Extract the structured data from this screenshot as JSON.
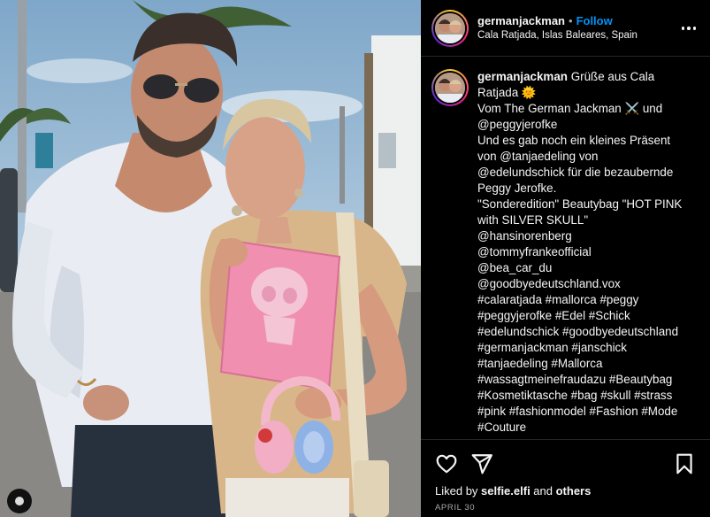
{
  "post": {
    "username": "germanjackman",
    "separator": "•",
    "follow_label": "Follow",
    "location": "Cala Ratjada, Islas Baleares, Spain",
    "caption_lines": [
      "Grüße aus Cala",
      "Ratjada 🌞",
      "Vom The German Jackman ⚔️ und",
      "@peggyjerofke",
      "Und es gab noch ein kleines Präsent",
      "von @tanjaedeling von",
      "@edelundschick für die bezaubernde",
      "Peggy Jerofke.",
      "\"Sonderedition\" Beautybag \"HOT PINK",
      "with SILVER SKULL\"",
      "@hansinorenberg",
      "@tommyfrankeofficial",
      "@bea_car_du",
      "@goodbyedeutschland.vox",
      "#calaratjada #mallorca #peggy",
      "#peggyjerofke #Edel #Schick",
      "#edelundschick #goodbyedeutschland",
      "#germanjackman #janschick",
      "#tanjaedeling #Mallorca",
      "#wassagtmeinefraudazu #Beautybag",
      "#Kosmetiktasche #bag #skull #strass",
      "#pink #fashionmodel #Fashion #Mode",
      "#Couture"
    ],
    "liked_by_prefix": "Liked by ",
    "liked_by_user": "selfie.elfi",
    "liked_by_suffix": " and ",
    "liked_by_others": "others",
    "date": "APRIL 30"
  },
  "icons": {
    "like": "heart-icon",
    "share": "paper-plane-icon",
    "save": "bookmark-icon",
    "more": "more-horizontal-icon"
  },
  "colors": {
    "accent": "#0095f6",
    "background": "#000000",
    "bag": "#f08fb0"
  }
}
